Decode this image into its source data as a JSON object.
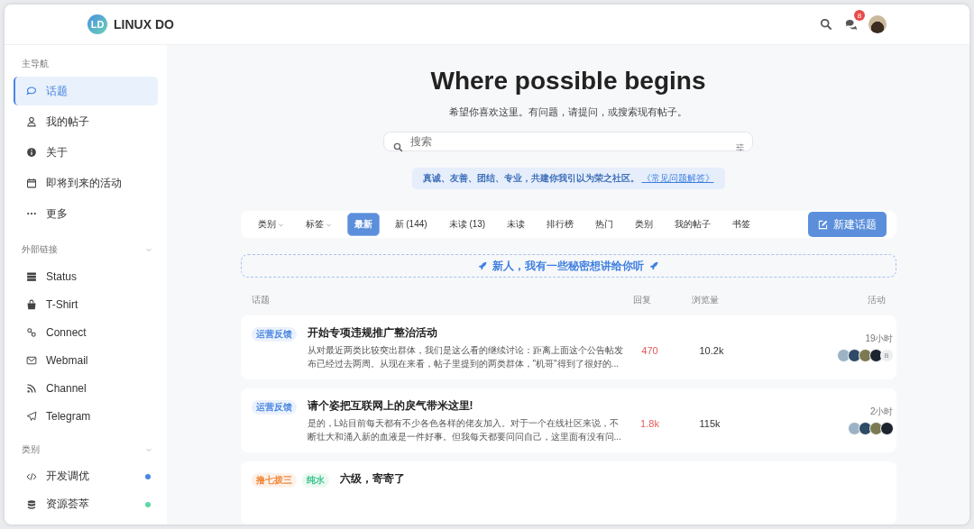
{
  "header": {
    "logo_initials": "LD",
    "site_name": "LINUX DO",
    "notification_count": "8"
  },
  "sidebar": {
    "sections": [
      {
        "title": "主导航",
        "items": [
          {
            "label": "话题",
            "kind": "chat",
            "selected": true
          },
          {
            "label": "我的帖子",
            "kind": "user",
            "selected": false
          },
          {
            "label": "关于",
            "kind": "info",
            "selected": false
          },
          {
            "label": "即将到来的活动",
            "kind": "calendar",
            "selected": false
          },
          {
            "label": "更多",
            "kind": "dots",
            "selected": false
          }
        ]
      },
      {
        "title": "外部链接",
        "expanded": true,
        "items": [
          {
            "label": "Status",
            "kind": "server",
            "selected": false
          },
          {
            "label": "T-Shirt",
            "kind": "bag",
            "selected": false
          },
          {
            "label": "Connect",
            "kind": "link",
            "selected": false
          },
          {
            "label": "Webmail",
            "kind": "mail",
            "selected": false
          },
          {
            "label": "Channel",
            "kind": "rss",
            "selected": false
          },
          {
            "label": "Telegram",
            "kind": "plane",
            "selected": false
          }
        ]
      },
      {
        "title": "类别",
        "expanded": true,
        "items": [
          {
            "label": "开发调优",
            "kind": "code",
            "selected": false,
            "color": "#4a86e0"
          },
          {
            "label": "资源荟萃",
            "kind": "database",
            "selected": false,
            "color": "#5fd6a6"
          }
        ]
      }
    ]
  },
  "hero": {
    "title": "Where possible begins",
    "subtitle": "希望你喜欢这里。有问题，请提问，或搜索现有帖子。",
    "search": {
      "placeholder": "搜索"
    },
    "notice": {
      "text": "真诚、友善、团结、专业，共建你我引以为荣之社区。",
      "link": "《常见问题解答》"
    }
  },
  "nav": {
    "items": [
      {
        "label": "类别",
        "dropdown": true,
        "selected": false
      },
      {
        "label": "标签",
        "dropdown": true,
        "selected": false
      },
      {
        "label": "最新",
        "dropdown": false,
        "selected": true
      },
      {
        "label": "新 (144)",
        "dropdown": false,
        "selected": false
      },
      {
        "label": "未读 (13)",
        "dropdown": false,
        "selected": false
      },
      {
        "label": "未读",
        "dropdown": false,
        "selected": false
      },
      {
        "label": "排行榜",
        "dropdown": false,
        "selected": false
      },
      {
        "label": "热门",
        "dropdown": false,
        "selected": false
      },
      {
        "label": "类别",
        "dropdown": false,
        "selected": false
      },
      {
        "label": "我的帖子",
        "dropdown": false,
        "selected": false
      },
      {
        "label": "书签",
        "dropdown": false,
        "selected": false
      }
    ],
    "new_topic_button": "新建话题"
  },
  "newcomer_banner": "新人，我有一些秘密想讲给你听",
  "table": {
    "columns": [
      "话题",
      "回复",
      "浏览量",
      "活动"
    ],
    "rows": [
      {
        "tags": [
          {
            "label": "运营反馈",
            "color": "#4a86e0"
          }
        ],
        "title": "开始专项违规推广整治活动",
        "excerpt": "从对最近两类比较突出群体，我们是这么看的继续讨论：距离上面这个公告帖发布已经过去两周。从现在来看，帖子里提到的两类群体，\"机哥\"得到了很好的...",
        "replies": "470",
        "views": "10.2k",
        "activity": "19小时",
        "posters": [
          {
            "kind": "photo"
          },
          {
            "kind": "photo"
          },
          {
            "kind": "photo"
          },
          {
            "kind": "photo"
          },
          {
            "kind": "letter",
            "letter": "B"
          }
        ]
      },
      {
        "tags": [
          {
            "label": "运营反馈",
            "color": "#4a86e0"
          }
        ],
        "title": "请个姿把互联网上的戾气带米这里!",
        "excerpt": "是的，L站目前每天都有不少各色各样的佬友加入。对于一个在线社区来说，不断壮大和涌入新的血液是一件好事。但我每天都要问问自己，这里面有没有问...",
        "replies": "1.8k",
        "views": "115k",
        "activity": "2小时",
        "posters": [
          {
            "kind": "photo"
          },
          {
            "kind": "photo"
          },
          {
            "kind": "photo"
          },
          {
            "kind": "photo"
          }
        ]
      },
      {
        "tags": [
          {
            "label": "撸七拨三",
            "color": "#f0883e"
          },
          {
            "label": "纯水",
            "color": "#3cc48b"
          }
        ],
        "title": "六级，寄寄了",
        "posters": []
      }
    ]
  }
}
